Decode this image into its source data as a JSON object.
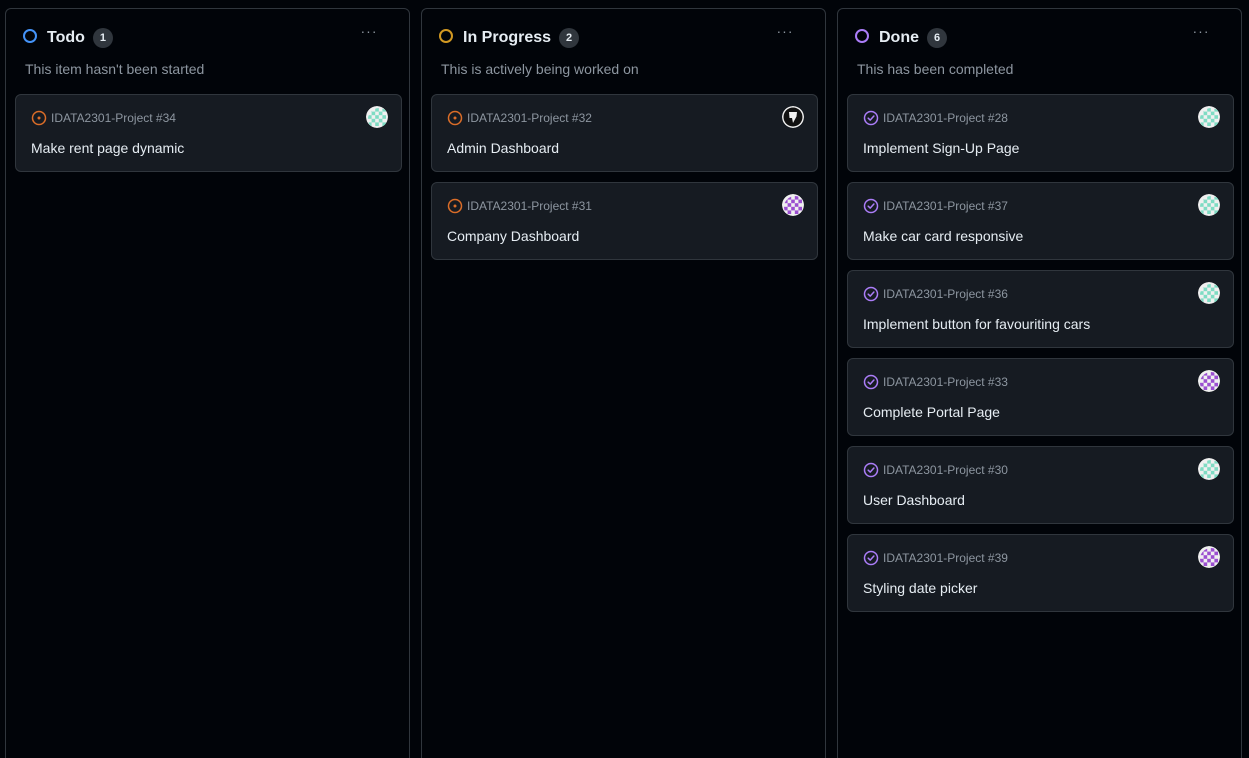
{
  "columns": [
    {
      "title": "Todo",
      "count": "1",
      "description": "This item hasn't been started",
      "status_color": "#4493f8",
      "menu_label": "···",
      "cards": [
        {
          "ref": "IDATA2301-Project #34",
          "title": "Make rent page dynamic",
          "state": "open",
          "avatar": "teal"
        }
      ]
    },
    {
      "title": "In Progress",
      "count": "2",
      "description": "This is actively being worked on",
      "status_color": "#d29922",
      "menu_label": "···",
      "cards": [
        {
          "ref": "IDATA2301-Project #32",
          "title": "Admin Dashboard",
          "state": "open",
          "avatar": "shield"
        },
        {
          "ref": "IDATA2301-Project #31",
          "title": "Company Dashboard",
          "state": "open",
          "avatar": "purple"
        }
      ]
    },
    {
      "title": "Done",
      "count": "6",
      "description": "This has been completed",
      "status_color": "#ab7df8",
      "menu_label": "···",
      "cards": [
        {
          "ref": "IDATA2301-Project #28",
          "title": "Implement Sign-Up Page",
          "state": "done",
          "avatar": "teal"
        },
        {
          "ref": "IDATA2301-Project #37",
          "title": "Make car card responsive",
          "state": "done",
          "avatar": "teal"
        },
        {
          "ref": "IDATA2301-Project #36",
          "title": "Implement button for favouriting cars",
          "state": "done",
          "avatar": "teal"
        },
        {
          "ref": "IDATA2301-Project #33",
          "title": "Complete Portal Page",
          "state": "done",
          "avatar": "purple"
        },
        {
          "ref": "IDATA2301-Project #30",
          "title": "User Dashboard",
          "state": "done",
          "avatar": "teal"
        },
        {
          "ref": "IDATA2301-Project #39",
          "title": "Styling date picker",
          "state": "done",
          "avatar": "purple"
        }
      ]
    }
  ],
  "colors": {
    "open_issue": "#db6d28",
    "done_issue": "#ab7df8",
    "avatar_teal": "#7fdcc4",
    "avatar_purple": "#9b4fd0"
  }
}
